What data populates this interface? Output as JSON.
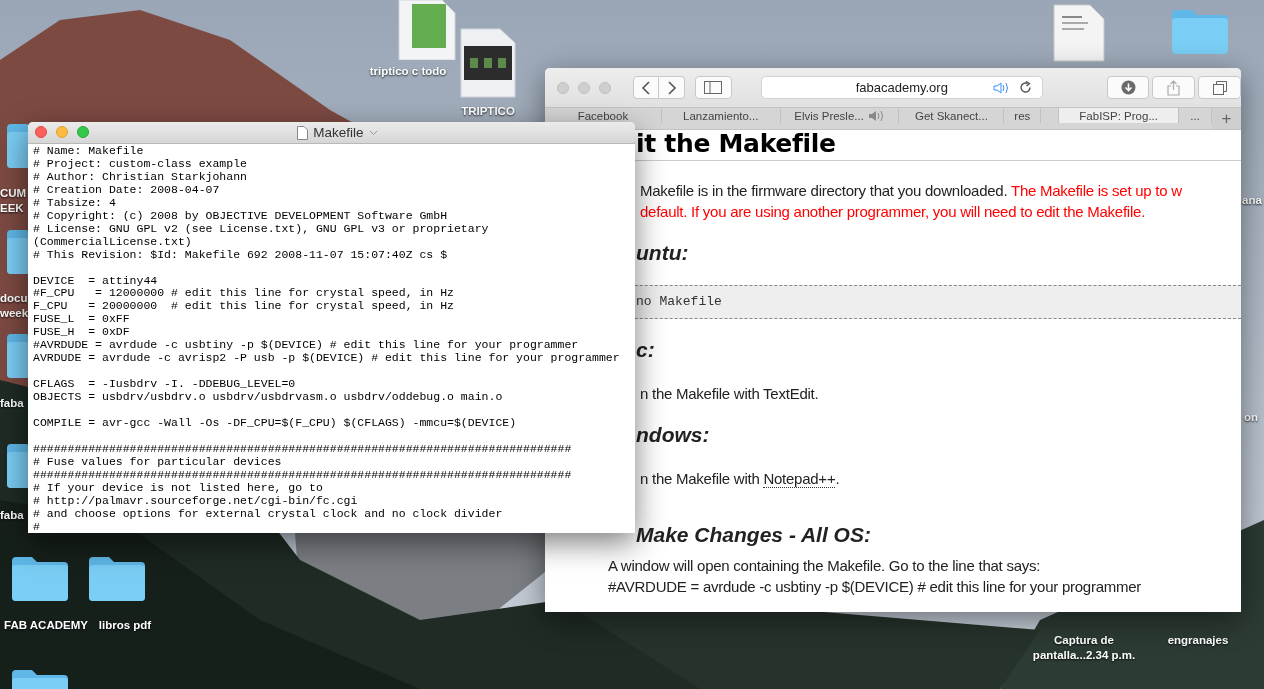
{
  "desktop_icons": [
    {
      "kind": "folder",
      "label": [
        "CUM",
        "EEK"
      ]
    },
    {
      "kind": "folder",
      "label": [
        "docu",
        "week"
      ]
    },
    {
      "kind": "folder",
      "label": [
        "faba"
      ]
    },
    {
      "kind": "folder",
      "label": [
        "faba"
      ]
    },
    {
      "kind": "folder",
      "label": [
        "FAB ACADEMY"
      ]
    },
    {
      "kind": "folder",
      "label": [
        "libros pdf"
      ]
    },
    {
      "kind": "folder"
    },
    {
      "kind": "document"
    },
    {
      "kind": "folder"
    },
    {
      "kind": "label",
      "label": [
        "ana"
      ]
    },
    {
      "kind": "label",
      "label": [
        "on"
      ]
    },
    {
      "kind": "label",
      "label": [
        "Captura de",
        "pantalla...2.34 p.m."
      ]
    },
    {
      "kind": "label",
      "label": [
        "engranajes"
      ]
    },
    {
      "kind": "sheet",
      "label": [
        "triptico c todo"
      ]
    },
    {
      "kind": "slides",
      "label": [
        "TRIPTICO"
      ]
    }
  ],
  "browser": {
    "focused": false,
    "address": "fabacademy.org",
    "tabs": [
      {
        "label": "Facebook",
        "selected": false,
        "audio": false
      },
      {
        "label": "Lanzamiento...",
        "selected": false,
        "audio": false
      },
      {
        "label": "Elvis Presle...",
        "selected": false,
        "audio": true
      },
      {
        "label": "Get Skanect...",
        "selected": false,
        "audio": false
      },
      {
        "label": "res",
        "selected": false,
        "audio": false
      },
      {
        "label": "FabISP: Prog...",
        "selected": true,
        "audio": false
      },
      {
        "label": "...",
        "selected": false,
        "audio": false
      }
    ],
    "new_tab": "+",
    "blocks": [
      {
        "kind": "title",
        "text": "it the Makefile"
      },
      {
        "kind": "paragraph",
        "lines": [
          [
            {
              "text": "Makefile is in the firmware directory that you downloaded. ",
              "color": "#222222",
              "kind": "text"
            },
            {
              "text": "The Makefile is set up to w",
              "color": "#ff0000",
              "kind": "text"
            }
          ],
          [
            {
              "text": "default. If you are using another programmer, you will need to edit the Makefile.",
              "color": "#ff0000",
              "kind": "text"
            }
          ]
        ]
      },
      {
        "kind": "heading",
        "text": "untu:"
      },
      {
        "kind": "code",
        "text": "no Makefile"
      },
      {
        "kind": "heading",
        "text": "c:"
      },
      {
        "kind": "paragraph",
        "lines": [
          [
            {
              "text": "n the Makefile with TextEdit.",
              "color": "#222222",
              "kind": "text"
            }
          ]
        ]
      },
      {
        "kind": "heading",
        "text": "ndows:"
      },
      {
        "kind": "paragraph",
        "lines": [
          [
            {
              "text": "n the Makefile with ",
              "color": "#222222",
              "kind": "text"
            },
            {
              "text": "Notepad++",
              "color": "#222222",
              "kind": "link"
            },
            {
              "text": ".",
              "color": "#222222",
              "kind": "text"
            }
          ]
        ]
      },
      {
        "kind": "heading",
        "text": "Make Changes - All OS:"
      },
      {
        "kind": "paragraph",
        "lines": [
          [
            {
              "text": "A window will open containing the Makefile. Go to the line that says:",
              "color": "#222222",
              "kind": "text"
            }
          ],
          [
            {
              "text": "#AVRDUDE = avrdude -c usbtiny -p $(DEVICE) # edit this line for your programmer",
              "color": "#222222",
              "kind": "text"
            }
          ]
        ]
      }
    ]
  },
  "editor": {
    "focused": true,
    "title": "Makefile",
    "text": "# Name: Makefile\n# Project: custom-class example\n# Author: Christian Starkjohann\n# Creation Date: 2008-04-07\n# Tabsize: 4\n# Copyright: (c) 2008 by OBJECTIVE DEVELOPMENT Software GmbH\n# License: GNU GPL v2 (see License.txt), GNU GPL v3 or proprietary\n(CommercialLicense.txt)\n# This Revision: $Id: Makefile 692 2008-11-07 15:07:40Z cs $\n\nDEVICE  = attiny44\n#F_CPU   = 12000000\t# edit this line for crystal speed, in Hz\nF_CPU   = 20000000\t# edit this line for crystal speed, in Hz\nFUSE_L  = 0xFF\nFUSE_H  = 0xDF\n#AVRDUDE = avrdude -c usbtiny -p $(DEVICE) # edit this line for your programmer\nAVRDUDE = avrdude -c avrisp2 -P usb -p $(DEVICE) # edit this line for your programmer\n\nCFLAGS  = -Iusbdrv -I. -DDEBUG_LEVEL=0\nOBJECTS = usbdrv/usbdrv.o usbdrv/usbdrvasm.o usbdrv/oddebug.o main.o\n\nCOMPILE = avr-gcc -Wall -Os -DF_CPU=$(F_CPU) $(CFLAGS) -mmcu=$(DEVICE)\n\n##############################################################################\n# Fuse values for particular devices\n##############################################################################\n# If your device is not listed here, go to\n# http://palmavr.sourceforge.net/cgi-bin/fc.cgi\n# and choose options for external crystal clock and no clock divider\n#"
  }
}
